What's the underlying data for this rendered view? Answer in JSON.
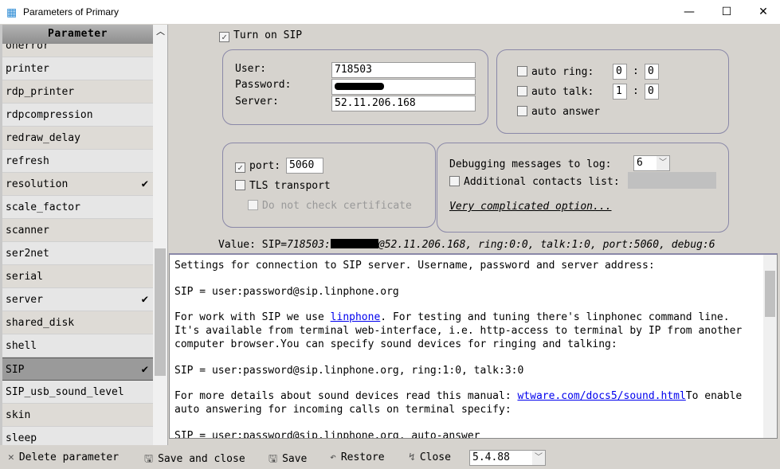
{
  "window": {
    "title": "Parameters of Primary",
    "minimize": "—",
    "maximize": "☐",
    "close": "✕"
  },
  "list": {
    "header": "Parameter",
    "items": [
      {
        "label": "onerror",
        "checked": false
      },
      {
        "label": "printer",
        "checked": false
      },
      {
        "label": "rdp_printer",
        "checked": false
      },
      {
        "label": "rdpcompression",
        "checked": false
      },
      {
        "label": "redraw_delay",
        "checked": false
      },
      {
        "label": "refresh",
        "checked": false
      },
      {
        "label": "resolution",
        "checked": true
      },
      {
        "label": "scale_factor",
        "checked": false
      },
      {
        "label": "scanner",
        "checked": false
      },
      {
        "label": "ser2net",
        "checked": false
      },
      {
        "label": "serial",
        "checked": false
      },
      {
        "label": "server",
        "checked": true
      },
      {
        "label": "shared_disk",
        "checked": false
      },
      {
        "label": "shell",
        "checked": false
      },
      {
        "label": "SIP",
        "checked": true,
        "selected": true
      },
      {
        "label": "SIP_usb_sound_level",
        "checked": false
      },
      {
        "label": "skin",
        "checked": false
      },
      {
        "label": "sleep",
        "checked": false
      }
    ]
  },
  "sip": {
    "turn_on": {
      "label": "Turn on SIP",
      "checked": true
    },
    "user_label": "User:",
    "user": "718503",
    "password_label": "Password:",
    "server_label": "Server:",
    "server": "52.11.206.168",
    "auto_ring": {
      "label": "auto ring:",
      "checked": false,
      "a": "0",
      "b": "0"
    },
    "auto_talk": {
      "label": "auto talk:",
      "checked": false,
      "a": "1",
      "b": "0"
    },
    "auto_answer": {
      "label": "auto answer",
      "checked": false
    },
    "sep": ":",
    "port": {
      "label": "port:",
      "checked": true,
      "value": "5060"
    },
    "tls": {
      "label": "TLS transport",
      "checked": false
    },
    "no_cert": {
      "label": "Do not check certificate",
      "checked": false,
      "disabled": true
    },
    "debug": {
      "label": "Debugging messages to log:",
      "value": "6"
    },
    "contacts": {
      "label": "Additional contacts list:",
      "checked": false
    },
    "complicated": "Very complicated option...",
    "value_label": "Value: SIP=",
    "value_user": "718503:",
    "value_rest": "@52.11.206.168, ring:0:0, talk:1:0, port:5060, debug:6"
  },
  "help": {
    "l1": "Settings for connection to SIP server. Username, password and server address:",
    "l2": "SIP = user:password@sip.linphone.org",
    "l3a": "For work with SIP we use ",
    "l3link": "linphone",
    "l3b": ". For testing and tuning there's linphonec command line.",
    "l4": "It's available from terminal web-interface, i.e. http-access to terminal by IP from another",
    "l5": "computer browser.You can specify sound devices for ringing and talking:",
    "l6": "SIP = user:password@sip.linphone.org, ring:1:0, talk:3:0",
    "l7a": "For more details about sound devices read this manual: ",
    "l7link": "wtware.com/docs5/sound.html",
    "l7b": "To enable",
    "l8": "auto answering for incoming calls on terminal specify:",
    "l9": "SIP = user:password@sip.linphone.org, auto-answer"
  },
  "toolbar": {
    "delete": "Delete parameter",
    "save_close": "Save and close",
    "save": "Save",
    "restore": "Restore",
    "close": "Close",
    "version": "5.4.88"
  }
}
